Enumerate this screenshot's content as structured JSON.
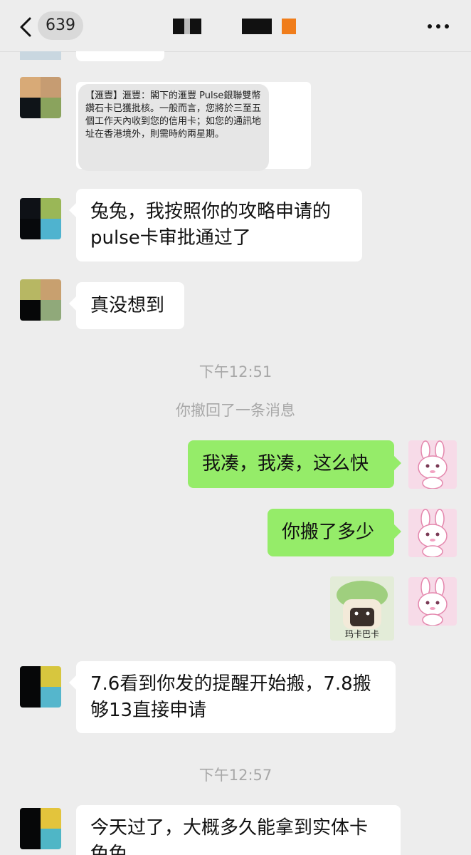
{
  "header": {
    "unread_count": "639"
  },
  "messages": {
    "sms_text": "【滙豐】滙豐：閣下的滙豐 Pulse銀聯雙幣鑽石卡已獲批核。一般而言，您將於三至五個工作天內收到您的信用卡；如您的通訊地址在香港境外，則需時約兩星期。",
    "m1": "兔兔，我按照你的攻略申请的\npulse卡审批通过了",
    "m2": "真没想到",
    "time1": "下午12:51",
    "recall": "你撤回了一条消息",
    "m3": "我凑，我凑，这么快",
    "m4": "你搬了多少",
    "sticker_caption": "玛卡巴卡",
    "m5": "7.6看到你发的提醒开始搬，7.8搬\n够13直接申请",
    "time2": "下午12:57",
    "m6": "今天过了，大概多久能拿到实体卡\n兔兔"
  }
}
